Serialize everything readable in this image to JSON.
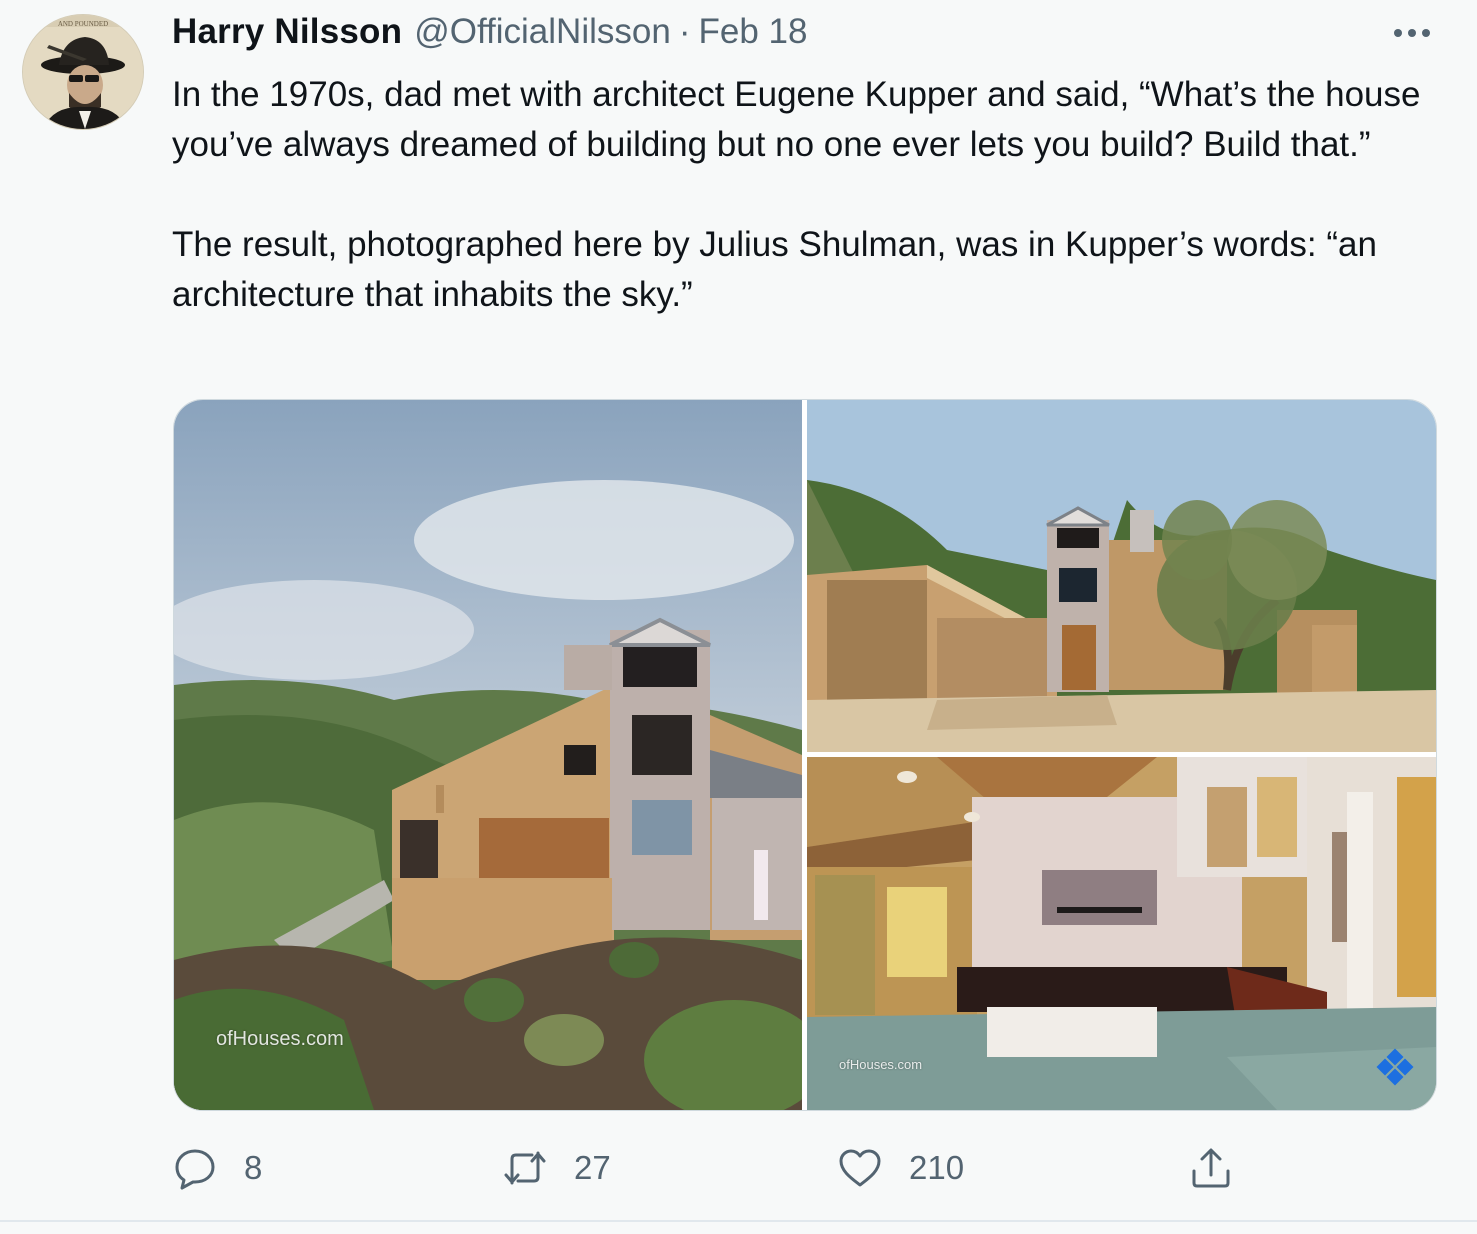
{
  "tweet": {
    "author_name": "Harry Nilsson",
    "author_handle": "@OfficialNilsson",
    "separator": "·",
    "date": "Feb 18",
    "paragraph_1": "In the 1970s, dad met with architect Eugene Kupper and said, “What’s the house you’ve always dreamed of building but no one ever lets you build? Build that.”",
    "paragraph_2": "The result, photographed here by Julius Shulman, was in Kupper’s words: “an architecture that inhabits the sky.”",
    "avatar_text": "AND POUNDED"
  },
  "media": {
    "photo_1": {
      "watermark": "ofHouses.com"
    },
    "photo_3": {
      "watermark": "ofHouses.com"
    }
  },
  "actions": {
    "reply_count": "8",
    "retweet_count": "27",
    "like_count": "210"
  },
  "icons": {
    "more": "more-icon",
    "reply": "reply-icon",
    "retweet": "retweet-icon",
    "like": "like-icon",
    "share": "share-icon"
  },
  "colors": {
    "text_primary": "#0f1419",
    "text_secondary": "#536471",
    "background": "#f7f9f9"
  }
}
